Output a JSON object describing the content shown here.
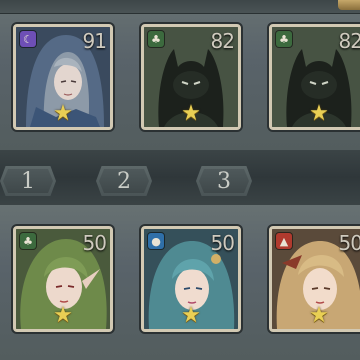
{
  "cards_top": [
    {
      "level": "91",
      "element_icon": "moon-icon",
      "element_color": "#6e4fb6",
      "stars": "★",
      "portrait": "hooded-woman"
    },
    {
      "level": "82",
      "element_icon": "leaf-icon",
      "element_color": "#3c6a3e",
      "stars": "★",
      "portrait": "shadow-creature"
    },
    {
      "level": "82",
      "element_icon": "leaf-icon",
      "element_color": "#3c6a3e",
      "stars": "★",
      "portrait": "shadow-creature"
    }
  ],
  "tabs": [
    {
      "label": "1"
    },
    {
      "label": "2"
    },
    {
      "label": "3"
    }
  ],
  "cards_bottom": [
    {
      "level": "50",
      "element_icon": "leaf-icon",
      "element_color": "#3c6a3e",
      "stars": "★",
      "portrait": "green-haired-elf"
    },
    {
      "level": "50",
      "element_icon": "water-drop-icon",
      "element_color": "#2f6fa8",
      "stars": "★",
      "portrait": "teal-haired-mage"
    },
    {
      "level": "50",
      "element_icon": "fire-icon",
      "element_color": "#b03a2e",
      "stars": "★",
      "portrait": "blonde-warrior"
    }
  ],
  "colors": {
    "frame": "#d2c9b3",
    "star": "#e9cf54",
    "background": "#5b6566"
  }
}
